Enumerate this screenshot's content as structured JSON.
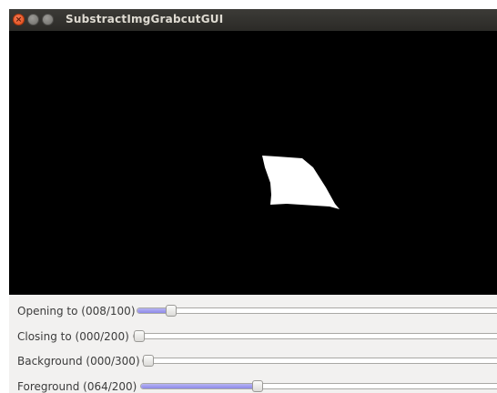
{
  "window": {
    "title": "SubstractImgGrabcutGUI",
    "close_glyph": "×"
  },
  "sliders": [
    {
      "label": "Opening to (008/100)",
      "value": 8,
      "max": 100
    },
    {
      "label": "Closing to (000/200)",
      "value": 0,
      "max": 200
    },
    {
      "label": "Background (000/300)",
      "value": 0,
      "max": 300
    },
    {
      "label": "Foreground (064/200)",
      "value": 64,
      "max": 200
    }
  ],
  "colors": {
    "slider_fill": "#8d89e8",
    "mask_foreground": "#ffffff",
    "canvas_background": "#000000"
  }
}
